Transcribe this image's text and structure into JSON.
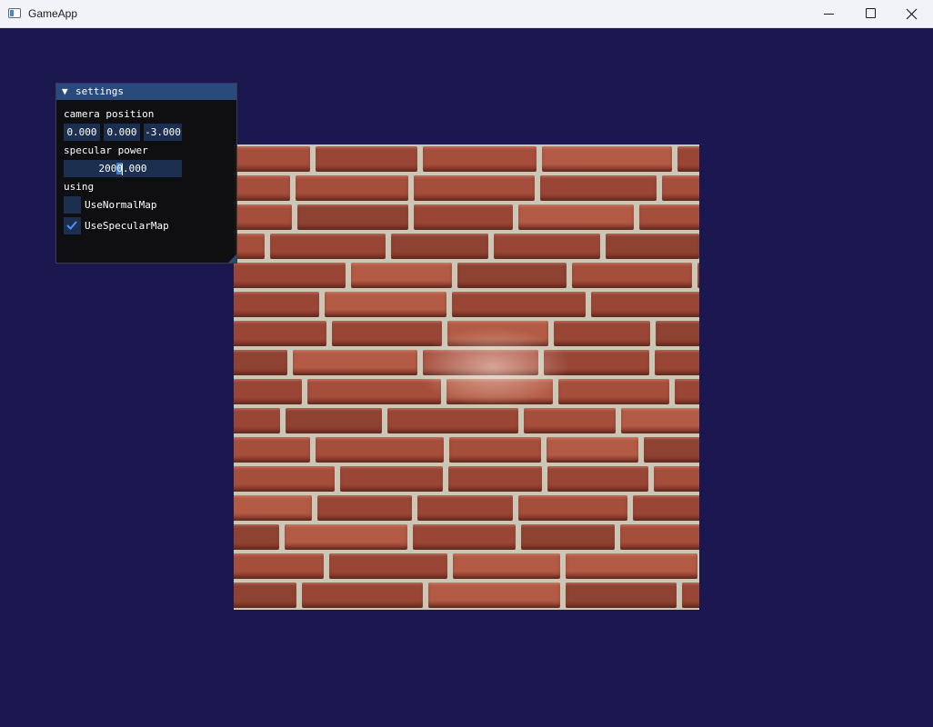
{
  "window": {
    "title": "GameApp",
    "controls": [
      "minimize",
      "maximize",
      "close"
    ],
    "background_color": "#1a184f"
  },
  "settings_panel": {
    "title": "settings",
    "collapse_icon": "triangle-down-icon",
    "camera_label": "camera position",
    "camera_position": [
      "0.000",
      "0.000",
      "-3.000"
    ],
    "specular_label": "specular power",
    "specular_power": "2000.000",
    "using_label": "using",
    "checkboxes": [
      {
        "label": "UseNormalMap",
        "checked": false
      },
      {
        "label": "UseSpecularMap",
        "checked": true
      }
    ]
  },
  "scene": {
    "object": "brick-wall-quad",
    "mortar_color": "#ccc6b6",
    "brick_colors": [
      "#a64e3c",
      "#9a4636",
      "#b25a44",
      "#8e4232"
    ]
  }
}
